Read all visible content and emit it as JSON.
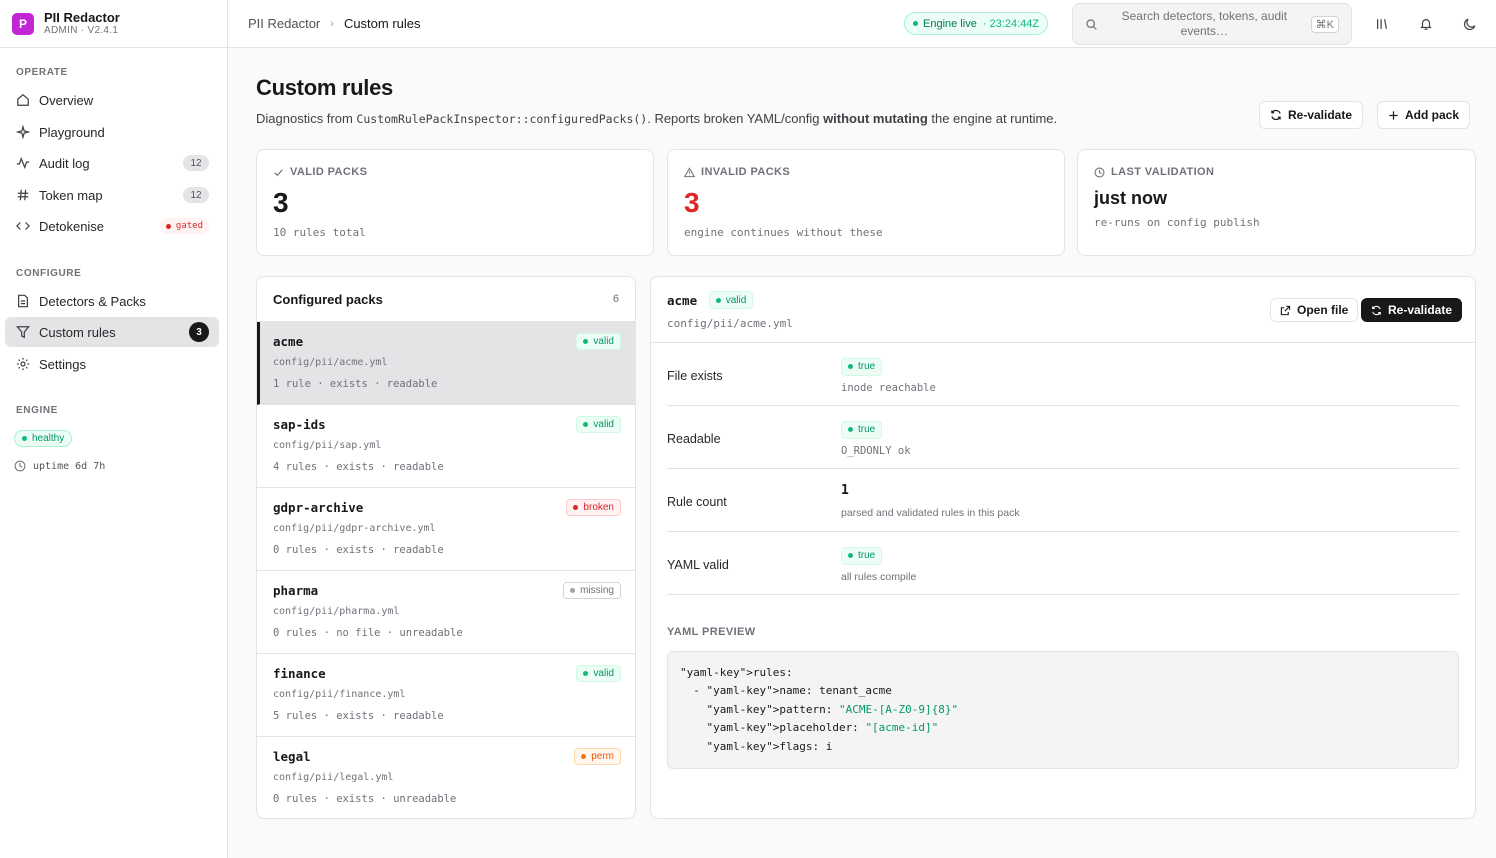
{
  "brand": {
    "logo": "P",
    "name": "PII Redactor",
    "version": "ADMIN · V2.4.1"
  },
  "sidebar": {
    "operate_label": "OPERATE",
    "configure_label": "CONFIGURE",
    "engine_label": "ENGINE",
    "items": [
      {
        "label": "Overview",
        "icon": "home-icon"
      },
      {
        "label": "Playground",
        "icon": "sparkle-icon"
      },
      {
        "label": "Audit log",
        "icon": "activity-icon",
        "count": "12"
      },
      {
        "label": "Token map",
        "icon": "hash-icon",
        "count": "12"
      },
      {
        "label": "Detokenise",
        "icon": "code-icon",
        "badge": "gated"
      },
      {
        "label": "Detectors & Packs",
        "icon": "file-icon"
      },
      {
        "label": "Custom rules",
        "icon": "filter-icon",
        "count": "3",
        "active": true
      },
      {
        "label": "Settings",
        "icon": "gear-icon"
      }
    ],
    "engine_status": "healthy",
    "uptime": "uptime 6d 7h"
  },
  "header": {
    "breadcrumb_root": "PII Redactor",
    "breadcrumb_current": "Custom rules",
    "engine_status": "Engine live",
    "engine_time": "· 23:24:44Z",
    "search_placeholder": "Search detectors, tokens, audit events…",
    "search_shortcut": "⌘K"
  },
  "page": {
    "title": "Custom rules",
    "desc_prefix": "Diagnostics from ",
    "desc_code": "CustomRulePackInspector::configuredPacks()",
    "desc_mid": ". Reports broken YAML/config ",
    "desc_bold": "without mutating",
    "desc_suffix": " the engine at runtime.",
    "revalidate_label": "Re-validate",
    "add_pack_label": "Add pack"
  },
  "stats": [
    {
      "label": "VALID PACKS",
      "value": "3",
      "sub": "10 rules total"
    },
    {
      "label": "INVALID PACKS",
      "value": "3",
      "sub": "engine continues without these"
    },
    {
      "label": "LAST VALIDATION",
      "value": "just now",
      "sub": "re-runs on config publish"
    }
  ],
  "packs": {
    "title": "Configured packs",
    "count": "6",
    "items": [
      {
        "name": "acme",
        "path": "config/pii/acme.yml",
        "meta": "1 rule · exists · readable",
        "status": "valid"
      },
      {
        "name": "sap-ids",
        "path": "config/pii/sap.yml",
        "meta": "4 rules · exists · readable",
        "status": "valid"
      },
      {
        "name": "gdpr-archive",
        "path": "config/pii/gdpr-archive.yml",
        "meta": "0 rules · exists · readable",
        "status": "broken"
      },
      {
        "name": "pharma",
        "path": "config/pii/pharma.yml",
        "meta": "0 rules · no file · unreadable",
        "status": "missing"
      },
      {
        "name": "finance",
        "path": "config/pii/finance.yml",
        "meta": "5 rules · exists · readable",
        "status": "valid"
      },
      {
        "name": "legal",
        "path": "config/pii/legal.yml",
        "meta": "0 rules · exists · unreadable",
        "status": "perm"
      }
    ]
  },
  "detail": {
    "name": "acme",
    "status": "valid",
    "path": "config/pii/acme.yml",
    "open_file_label": "Open file",
    "revalidate_label": "Re-validate",
    "rows": [
      {
        "label": "File exists",
        "value": "true",
        "sub": "inode reachable"
      },
      {
        "label": "Readable",
        "value": "true",
        "sub": "O_RDONLY ok"
      },
      {
        "label": "Rule count",
        "value": "1",
        "sub": "parsed and validated rules in this pack"
      },
      {
        "label": "YAML valid",
        "value": "true",
        "sub": "all rules compile"
      }
    ],
    "yaml_label": "YAML PREVIEW",
    "yaml_lines": [
      {
        "key": "\"yaml-key\">rules:",
        "str": ""
      },
      {
        "key": "  - \"yaml-key\">name: tenant_acme",
        "str": ""
      },
      {
        "key": "    \"yaml-key\">pattern: ",
        "str": "\"ACME-[A-Z0-9]{8}\""
      },
      {
        "key": "    \"yaml-key\">placeholder: ",
        "str": "\"[acme-id]\""
      },
      {
        "key": "    \"yaml-key\">flags: i",
        "str": ""
      }
    ]
  },
  "colors": {
    "accent": "#18181b",
    "brand": "#c026d3",
    "valid": "#059669",
    "broken": "#dc2626",
    "perm": "#ea580c"
  }
}
